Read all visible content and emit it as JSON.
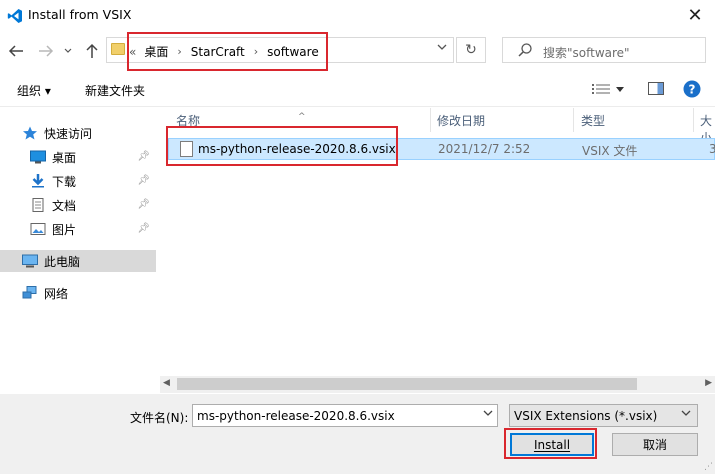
{
  "window": {
    "title": "Install from VSIX",
    "close_glyph": "✕"
  },
  "nav": {
    "breadcrumbs": [
      "桌面",
      "StarCraft",
      "software"
    ],
    "overflow": "«",
    "search_placeholder": "搜索\"software\""
  },
  "toolbar": {
    "organize": "组织 ▾",
    "new_folder": "新建文件夹"
  },
  "sidebar": {
    "items": [
      {
        "label": "快速访问",
        "icon": "star-icon"
      },
      {
        "label": "桌面",
        "icon": "desktop-icon",
        "pinned": true
      },
      {
        "label": "下载",
        "icon": "download-icon",
        "pinned": true
      },
      {
        "label": "文档",
        "icon": "document-icon",
        "pinned": true
      },
      {
        "label": "图片",
        "icon": "picture-icon",
        "pinned": true
      },
      {
        "label": "此电脑",
        "icon": "computer-icon",
        "selected": true
      },
      {
        "label": "网络",
        "icon": "network-icon"
      }
    ]
  },
  "file_list": {
    "columns": [
      "名称",
      "修改日期",
      "类型",
      "大小"
    ],
    "rows": [
      {
        "name": "ms-python-release-2020.8.6.vsix",
        "date": "2021/12/7 2:52",
        "type": "VSIX 文件",
        "size": "3"
      }
    ]
  },
  "footer": {
    "filename_label": "文件名(N):",
    "filename_value": "ms-python-release-2020.8.6.vsix",
    "filter_value": "VSIX Extensions (*.vsix)",
    "install_label": "Install",
    "cancel_label": "取消"
  },
  "colors": {
    "highlight_red": "#d9272e",
    "selection_blue": "#cce8ff",
    "vscode_blue": "#0078d7"
  }
}
